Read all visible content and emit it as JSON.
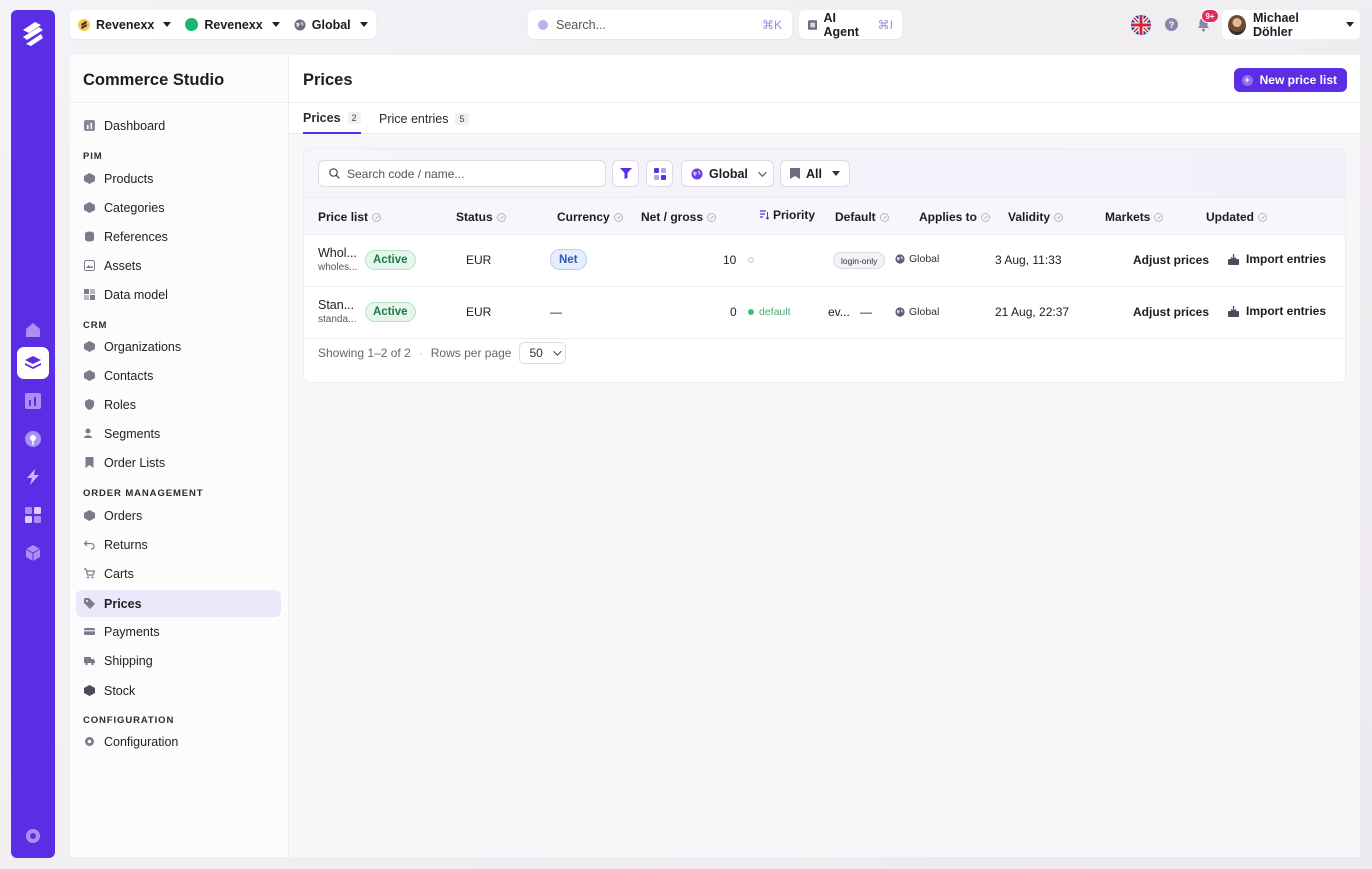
{
  "topbar": {
    "org": "Revenexx",
    "store": "Revenexx",
    "region": "Global",
    "search_placeholder": "Search...",
    "search_shortcut": "⌘K",
    "ai_label": "AI Agent",
    "ai_shortcut": "⌘I",
    "notifications_badge": "9+",
    "help_glyph": "?",
    "user_name": "Michael Döhler"
  },
  "sidebar": {
    "title": "Commerce Studio",
    "dashboard": "Dashboard",
    "sections": {
      "pim": "PIM",
      "crm": "CRM",
      "order": "ORDER MANAGEMENT",
      "config": "CONFIGURATION"
    },
    "pim_items": [
      "Products",
      "Categories",
      "References",
      "Assets",
      "Data model"
    ],
    "crm_items": [
      "Organizations",
      "Contacts",
      "Roles",
      "Segments",
      "Order Lists"
    ],
    "order_items": [
      "Orders",
      "Returns",
      "Carts",
      "Prices",
      "Payments",
      "Shipping",
      "Stock"
    ],
    "config_items": [
      "Configuration"
    ],
    "active": "Prices"
  },
  "page": {
    "title": "Prices",
    "new_button": "New price list",
    "tabs": [
      {
        "label": "Prices",
        "count": "2"
      },
      {
        "label": "Price entries",
        "count": "5"
      }
    ]
  },
  "filters": {
    "search_placeholder": "Search code / name...",
    "region": "Global",
    "scope": "All"
  },
  "table": {
    "columns": [
      "Price list",
      "Status",
      "Currency",
      "Net / gross",
      "Priority",
      "Default",
      "Applies to",
      "Validity",
      "Markets",
      "Updated"
    ],
    "rows": [
      {
        "name": "Whol...",
        "code": "wholes...",
        "status": "Active",
        "currency": "EUR",
        "net_gross": "Net",
        "priority": "10",
        "default": "",
        "applies_to": "login-only",
        "market": "Global",
        "updated": "3 Aug, 11:33",
        "action1": "Adjust prices",
        "action2": "Import entries"
      },
      {
        "name": "Stan...",
        "code": "standa...",
        "status": "Active",
        "currency": "EUR",
        "net_gross": "—",
        "priority": "0",
        "default": "default",
        "applies_to": "ev...",
        "validity": "—",
        "market": "Global",
        "updated": "21 Aug, 22:37",
        "action1": "Adjust prices",
        "action2": "Import entries"
      }
    ]
  },
  "footer": {
    "showing": "Showing 1–2 of 2",
    "sep": "·",
    "rows_label": "Rows per page",
    "rows_value": "50"
  },
  "colors": {
    "brand": "#5b2ee6",
    "active_green": "#1d7a44",
    "net_blue": "#2c58b8",
    "badge_red": "#e32a5a"
  }
}
